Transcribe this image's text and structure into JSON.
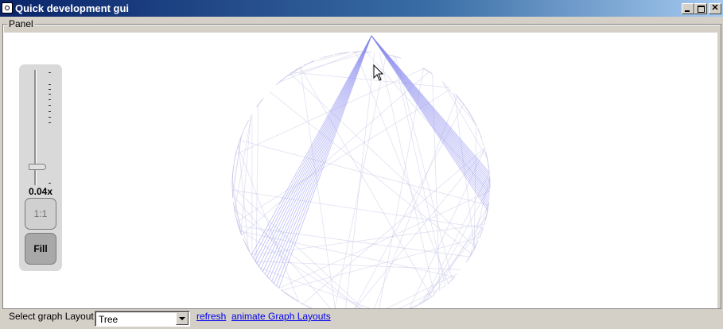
{
  "window": {
    "title": "Quick development gui",
    "controls": {
      "minimize": "minimize-icon",
      "maximize": "maximize-icon",
      "close": "✕"
    }
  },
  "panel": {
    "label": "Panel"
  },
  "zoom": {
    "level_label": "0.04x",
    "one_to_one_label": "1:1",
    "fill_label": "Fill"
  },
  "graph": {
    "edge_color": "#8888ee",
    "faint_edge_color": "#c8c8e8"
  },
  "bottom_bar": {
    "layout_label": "Select graph Layout",
    "layout_selected": "Tree",
    "refresh_label": "refresh",
    "animate_label": "animate Graph Layouts"
  }
}
